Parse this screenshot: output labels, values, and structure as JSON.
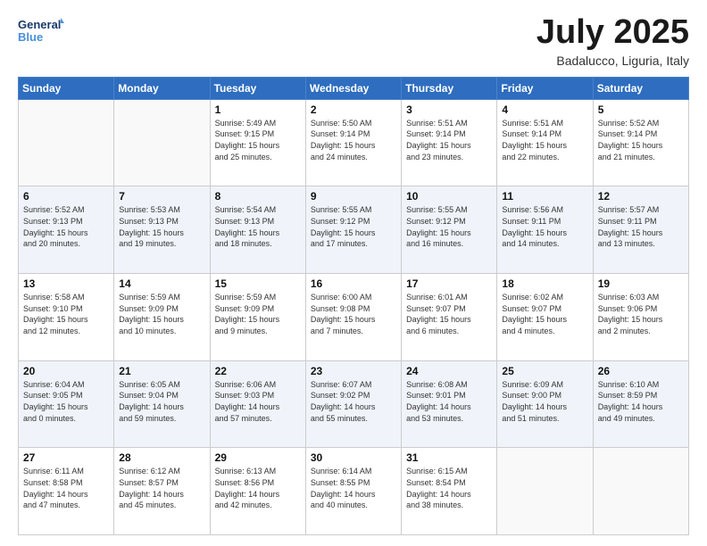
{
  "logo": {
    "line1": "General",
    "line2": "Blue"
  },
  "title": "July 2025",
  "location": "Badalucco, Liguria, Italy",
  "weekdays": [
    "Sunday",
    "Monday",
    "Tuesday",
    "Wednesday",
    "Thursday",
    "Friday",
    "Saturday"
  ],
  "weeks": [
    [
      {
        "day": "",
        "detail": ""
      },
      {
        "day": "",
        "detail": ""
      },
      {
        "day": "1",
        "detail": "Sunrise: 5:49 AM\nSunset: 9:15 PM\nDaylight: 15 hours\nand 25 minutes."
      },
      {
        "day": "2",
        "detail": "Sunrise: 5:50 AM\nSunset: 9:14 PM\nDaylight: 15 hours\nand 24 minutes."
      },
      {
        "day": "3",
        "detail": "Sunrise: 5:51 AM\nSunset: 9:14 PM\nDaylight: 15 hours\nand 23 minutes."
      },
      {
        "day": "4",
        "detail": "Sunrise: 5:51 AM\nSunset: 9:14 PM\nDaylight: 15 hours\nand 22 minutes."
      },
      {
        "day": "5",
        "detail": "Sunrise: 5:52 AM\nSunset: 9:14 PM\nDaylight: 15 hours\nand 21 minutes."
      }
    ],
    [
      {
        "day": "6",
        "detail": "Sunrise: 5:52 AM\nSunset: 9:13 PM\nDaylight: 15 hours\nand 20 minutes."
      },
      {
        "day": "7",
        "detail": "Sunrise: 5:53 AM\nSunset: 9:13 PM\nDaylight: 15 hours\nand 19 minutes."
      },
      {
        "day": "8",
        "detail": "Sunrise: 5:54 AM\nSunset: 9:13 PM\nDaylight: 15 hours\nand 18 minutes."
      },
      {
        "day": "9",
        "detail": "Sunrise: 5:55 AM\nSunset: 9:12 PM\nDaylight: 15 hours\nand 17 minutes."
      },
      {
        "day": "10",
        "detail": "Sunrise: 5:55 AM\nSunset: 9:12 PM\nDaylight: 15 hours\nand 16 minutes."
      },
      {
        "day": "11",
        "detail": "Sunrise: 5:56 AM\nSunset: 9:11 PM\nDaylight: 15 hours\nand 14 minutes."
      },
      {
        "day": "12",
        "detail": "Sunrise: 5:57 AM\nSunset: 9:11 PM\nDaylight: 15 hours\nand 13 minutes."
      }
    ],
    [
      {
        "day": "13",
        "detail": "Sunrise: 5:58 AM\nSunset: 9:10 PM\nDaylight: 15 hours\nand 12 minutes."
      },
      {
        "day": "14",
        "detail": "Sunrise: 5:59 AM\nSunset: 9:09 PM\nDaylight: 15 hours\nand 10 minutes."
      },
      {
        "day": "15",
        "detail": "Sunrise: 5:59 AM\nSunset: 9:09 PM\nDaylight: 15 hours\nand 9 minutes."
      },
      {
        "day": "16",
        "detail": "Sunrise: 6:00 AM\nSunset: 9:08 PM\nDaylight: 15 hours\nand 7 minutes."
      },
      {
        "day": "17",
        "detail": "Sunrise: 6:01 AM\nSunset: 9:07 PM\nDaylight: 15 hours\nand 6 minutes."
      },
      {
        "day": "18",
        "detail": "Sunrise: 6:02 AM\nSunset: 9:07 PM\nDaylight: 15 hours\nand 4 minutes."
      },
      {
        "day": "19",
        "detail": "Sunrise: 6:03 AM\nSunset: 9:06 PM\nDaylight: 15 hours\nand 2 minutes."
      }
    ],
    [
      {
        "day": "20",
        "detail": "Sunrise: 6:04 AM\nSunset: 9:05 PM\nDaylight: 15 hours\nand 0 minutes."
      },
      {
        "day": "21",
        "detail": "Sunrise: 6:05 AM\nSunset: 9:04 PM\nDaylight: 14 hours\nand 59 minutes."
      },
      {
        "day": "22",
        "detail": "Sunrise: 6:06 AM\nSunset: 9:03 PM\nDaylight: 14 hours\nand 57 minutes."
      },
      {
        "day": "23",
        "detail": "Sunrise: 6:07 AM\nSunset: 9:02 PM\nDaylight: 14 hours\nand 55 minutes."
      },
      {
        "day": "24",
        "detail": "Sunrise: 6:08 AM\nSunset: 9:01 PM\nDaylight: 14 hours\nand 53 minutes."
      },
      {
        "day": "25",
        "detail": "Sunrise: 6:09 AM\nSunset: 9:00 PM\nDaylight: 14 hours\nand 51 minutes."
      },
      {
        "day": "26",
        "detail": "Sunrise: 6:10 AM\nSunset: 8:59 PM\nDaylight: 14 hours\nand 49 minutes."
      }
    ],
    [
      {
        "day": "27",
        "detail": "Sunrise: 6:11 AM\nSunset: 8:58 PM\nDaylight: 14 hours\nand 47 minutes."
      },
      {
        "day": "28",
        "detail": "Sunrise: 6:12 AM\nSunset: 8:57 PM\nDaylight: 14 hours\nand 45 minutes."
      },
      {
        "day": "29",
        "detail": "Sunrise: 6:13 AM\nSunset: 8:56 PM\nDaylight: 14 hours\nand 42 minutes."
      },
      {
        "day": "30",
        "detail": "Sunrise: 6:14 AM\nSunset: 8:55 PM\nDaylight: 14 hours\nand 40 minutes."
      },
      {
        "day": "31",
        "detail": "Sunrise: 6:15 AM\nSunset: 8:54 PM\nDaylight: 14 hours\nand 38 minutes."
      },
      {
        "day": "",
        "detail": ""
      },
      {
        "day": "",
        "detail": ""
      }
    ]
  ]
}
